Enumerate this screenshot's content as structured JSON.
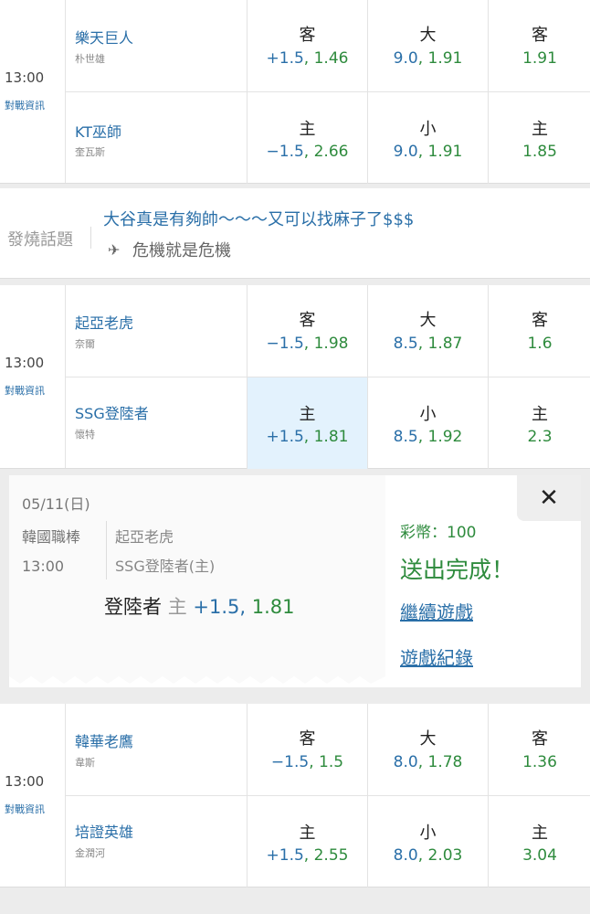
{
  "games": [
    {
      "time": "13:00",
      "info_label": "對戰資訊",
      "rows": [
        {
          "team": "樂天巨人",
          "pitcher": "朴世雄",
          "spread": {
            "label": "客",
            "handicap": "+1.5",
            "odds": "1.46"
          },
          "total": {
            "label": "大",
            "line": "9.0",
            "odds": "1.91"
          },
          "moneyline": {
            "label": "客",
            "odds": "1.91"
          }
        },
        {
          "team": "KT巫師",
          "pitcher": "奎瓦斯",
          "spread": {
            "label": "主",
            "handicap": "−1.5",
            "odds": "2.66"
          },
          "total": {
            "label": "小",
            "line": "9.0",
            "odds": "1.91"
          },
          "moneyline": {
            "label": "主",
            "odds": "1.85"
          }
        }
      ]
    },
    {
      "time": "13:00",
      "info_label": "對戰資訊",
      "rows": [
        {
          "team": "起亞老虎",
          "pitcher": "奈爾",
          "spread": {
            "label": "客",
            "handicap": "−1.5",
            "odds": "1.98"
          },
          "total": {
            "label": "大",
            "line": "8.5",
            "odds": "1.87"
          },
          "moneyline": {
            "label": "客",
            "odds": "1.6"
          }
        },
        {
          "team": "SSG登陸者",
          "pitcher": "懷特",
          "spread": {
            "label": "主",
            "handicap": "+1.5",
            "odds": "1.81"
          },
          "total": {
            "label": "小",
            "line": "8.5",
            "odds": "1.92"
          },
          "moneyline": {
            "label": "主",
            "odds": "2.3"
          }
        }
      ]
    },
    {
      "time": "13:00",
      "info_label": "對戰資訊",
      "rows": [
        {
          "team": "韓華老鷹",
          "pitcher": "韋斯",
          "spread": {
            "label": "客",
            "handicap": "−1.5",
            "odds": "1.5"
          },
          "total": {
            "label": "大",
            "line": "8.0",
            "odds": "1.78"
          },
          "moneyline": {
            "label": "客",
            "odds": "1.36"
          }
        },
        {
          "team": "培證英雄",
          "pitcher": "金潤河",
          "spread": {
            "label": "主",
            "handicap": "+1.5",
            "odds": "2.55"
          },
          "total": {
            "label": "小",
            "line": "8.0",
            "odds": "2.03"
          },
          "moneyline": {
            "label": "主",
            "odds": "3.04"
          }
        }
      ]
    }
  ],
  "chat": {
    "tag": "發燒話題",
    "message_1": "大谷真是有夠帥～～～又可以找麻子了$$$",
    "message_2": "危機就是危機"
  },
  "bet_popup": {
    "date": "05/11(日)",
    "league": "韓國職棒",
    "time": "13:00",
    "away_team": "起亞老虎",
    "home_team": "SSG登陸者(主)",
    "pick_team": "登陸者",
    "pick_side": "主",
    "pick_line": "+1.5,",
    "pick_odds": "1.81",
    "credits": "彩幣：100",
    "status": "送出完成！",
    "continue_label": "繼續遊戲",
    "history_label": "遊戲紀錄",
    "close_symbol": "✕"
  }
}
